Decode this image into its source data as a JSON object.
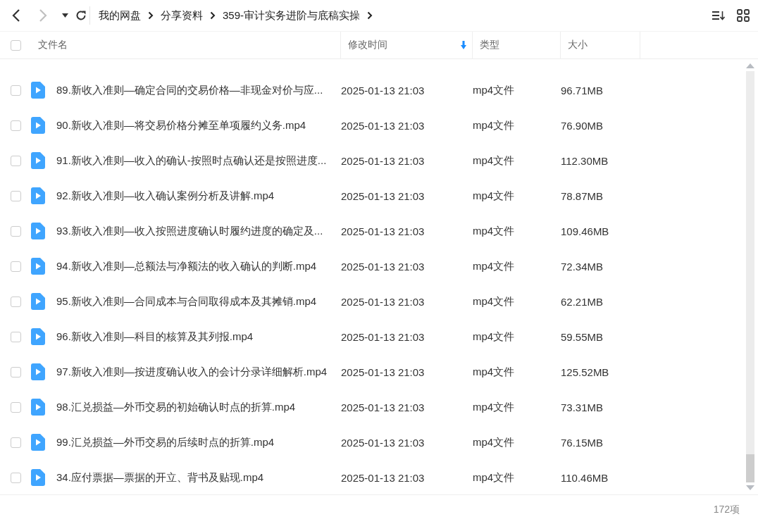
{
  "nav": {
    "back": {
      "disabled": false
    },
    "forward": {
      "disabled": true
    }
  },
  "breadcrumb": [
    "我的网盘",
    "分享资料",
    "359-审计实务进阶与底稿实操"
  ],
  "header": {
    "select_all": {
      "checked": false
    },
    "columns": [
      {
        "label": "文件名",
        "sorted": false
      },
      {
        "label": "修改时间",
        "sorted": true
      },
      {
        "label": "类型",
        "sorted": false
      },
      {
        "label": "大小",
        "sorted": false
      }
    ]
  },
  "rows": [
    {
      "name": "89.新收入准则—确定合同的交易价格—非现金对价与应...",
      "modified": "2025-01-13 21:03",
      "type": "mp4文件",
      "size": "96.71MB",
      "checked": false
    },
    {
      "name": "90.新收入准则—将交易价格分摊至单项履约义务.mp4",
      "modified": "2025-01-13 21:03",
      "type": "mp4文件",
      "size": "76.90MB",
      "checked": false
    },
    {
      "name": "91.新收入准则—收入的确认-按照时点确认还是按照进度...",
      "modified": "2025-01-13 21:03",
      "type": "mp4文件",
      "size": "112.30MB",
      "checked": false
    },
    {
      "name": "92.新收入准则—收入确认案例分析及讲解.mp4",
      "modified": "2025-01-13 21:03",
      "type": "mp4文件",
      "size": "78.87MB",
      "checked": false
    },
    {
      "name": "93.新收入准则—收入按照进度确认时履约进度的确定及...",
      "modified": "2025-01-13 21:03",
      "type": "mp4文件",
      "size": "109.46MB",
      "checked": false
    },
    {
      "name": "94.新收入准则—总额法与净额法的收入确认的判断.mp4",
      "modified": "2025-01-13 21:03",
      "type": "mp4文件",
      "size": "72.34MB",
      "checked": false
    },
    {
      "name": "95.新收入准则—合同成本与合同取得成本及其摊销.mp4",
      "modified": "2025-01-13 21:03",
      "type": "mp4文件",
      "size": "62.21MB",
      "checked": false
    },
    {
      "name": "96.新收入准则—科目的核算及其列报.mp4",
      "modified": "2025-01-13 21:03",
      "type": "mp4文件",
      "size": "59.55MB",
      "checked": false
    },
    {
      "name": "97.新收入准则—按进度确认收入的会计分录详细解析.mp4",
      "modified": "2025-01-13 21:03",
      "type": "mp4文件",
      "size": "125.52MB",
      "checked": false
    },
    {
      "name": "98.汇兑损益—外币交易的初始确认时点的折算.mp4",
      "modified": "2025-01-13 21:03",
      "type": "mp4文件",
      "size": "73.31MB",
      "checked": false
    },
    {
      "name": "99.汇兑损益—外币交易的后续时点的折算.mp4",
      "modified": "2025-01-13 21:03",
      "type": "mp4文件",
      "size": "76.15MB",
      "checked": false
    },
    {
      "name": "34.应付票据—票据的开立、背书及贴现.mp4",
      "modified": "2025-01-13 21:03",
      "type": "mp4文件",
      "size": "110.46MB",
      "checked": false
    }
  ],
  "status_bar": {
    "count": "172项"
  }
}
